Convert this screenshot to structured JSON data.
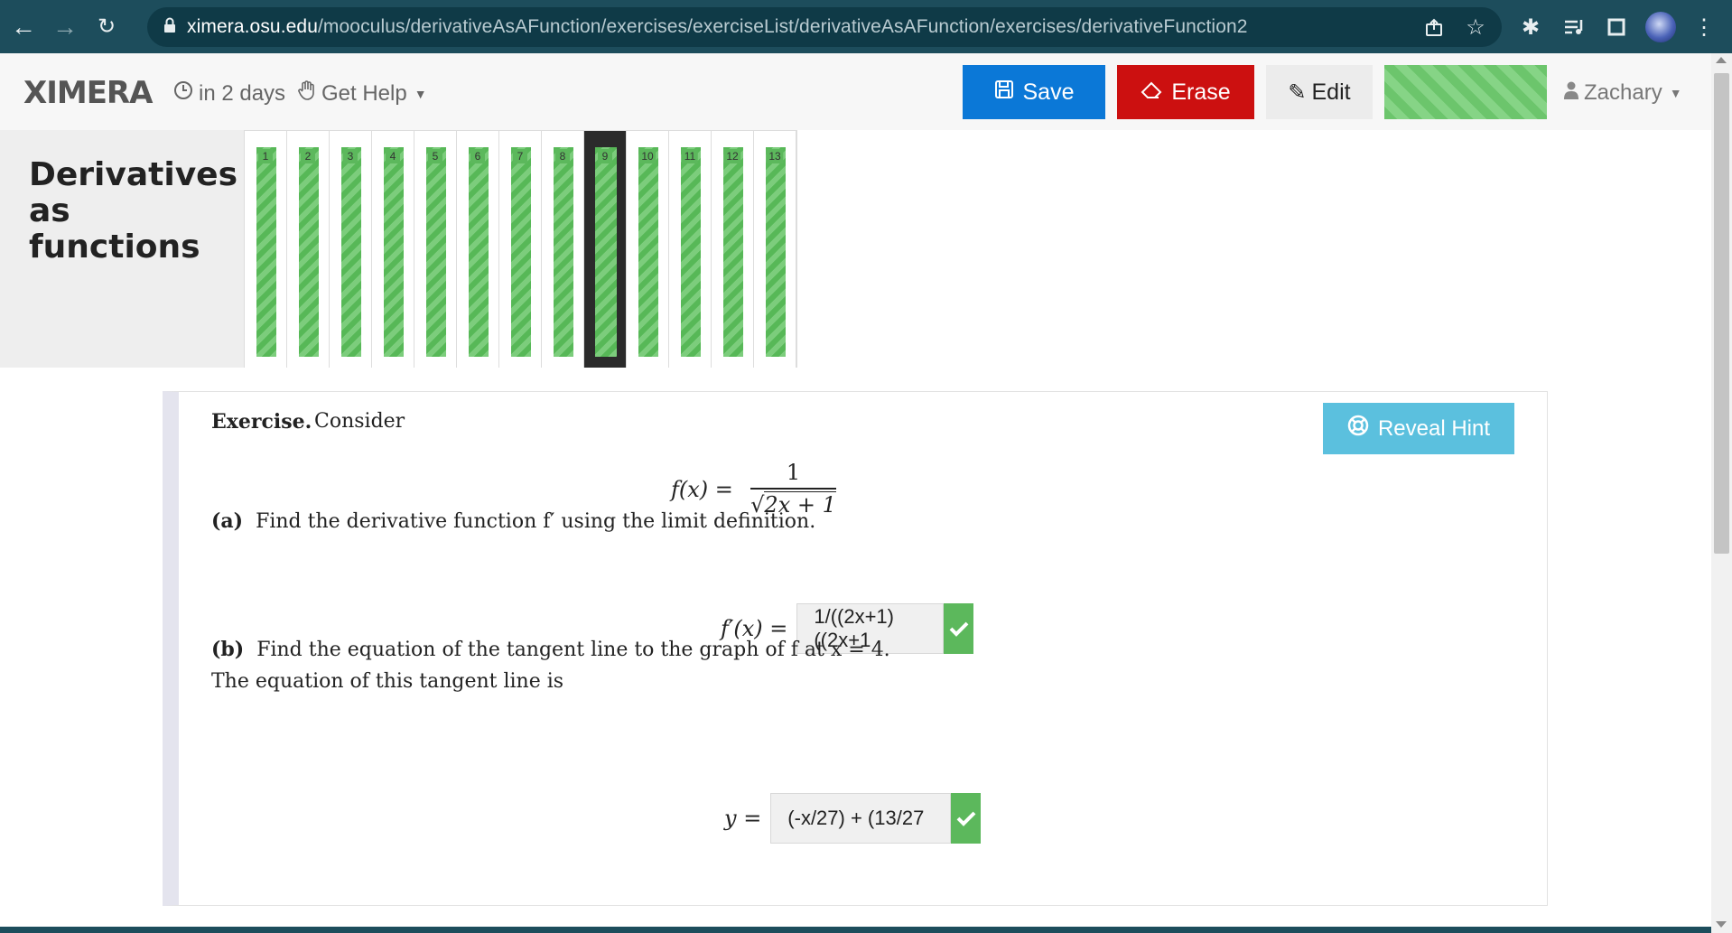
{
  "browser": {
    "url_host": "ximera.osu.edu",
    "url_path": "/mooculus/derivativeAsAFunction/exercises/exerciseList/derivativeAsAFunction/exercises/derivativeFunction2"
  },
  "header": {
    "logo": "XIMERA",
    "due": "in 2 days",
    "get_help": "Get Help",
    "save": "Save",
    "erase": "Erase",
    "edit": "Edit",
    "user": "Zachary"
  },
  "page_title": "Derivatives as functions",
  "problem_nav": {
    "items": [
      "1",
      "2",
      "3",
      "4",
      "5",
      "6",
      "7",
      "8",
      "9",
      "10",
      "11",
      "12",
      "13"
    ],
    "active": "9"
  },
  "exercise": {
    "label": "Exercise.",
    "intro": "Consider",
    "reveal_hint": "Reveal Hint",
    "formula_lhs": "f(x) =",
    "formula_numerator": "1",
    "formula_denominator": "2x + 1",
    "part_a_tag": "(a)",
    "part_a_text": "Find the derivative function f′ using the limit definition.",
    "answer_a_lhs": "f′(x) =",
    "answer_a_value": "1/((2x+1)((2x+1",
    "part_b_tag": "(b)",
    "part_b_text": "Find the equation of the tangent line to the graph of f at x = 4.",
    "part_b_followup": "The equation of this tangent line is",
    "answer_b_lhs": "y =",
    "answer_b_value": "(-x/27) + (13/27"
  },
  "colors": {
    "save": "#0b78d7",
    "erase": "#cc1010",
    "correct": "#5cb85c",
    "hint": "#5bc0de",
    "browser": "#1d4d5c"
  }
}
